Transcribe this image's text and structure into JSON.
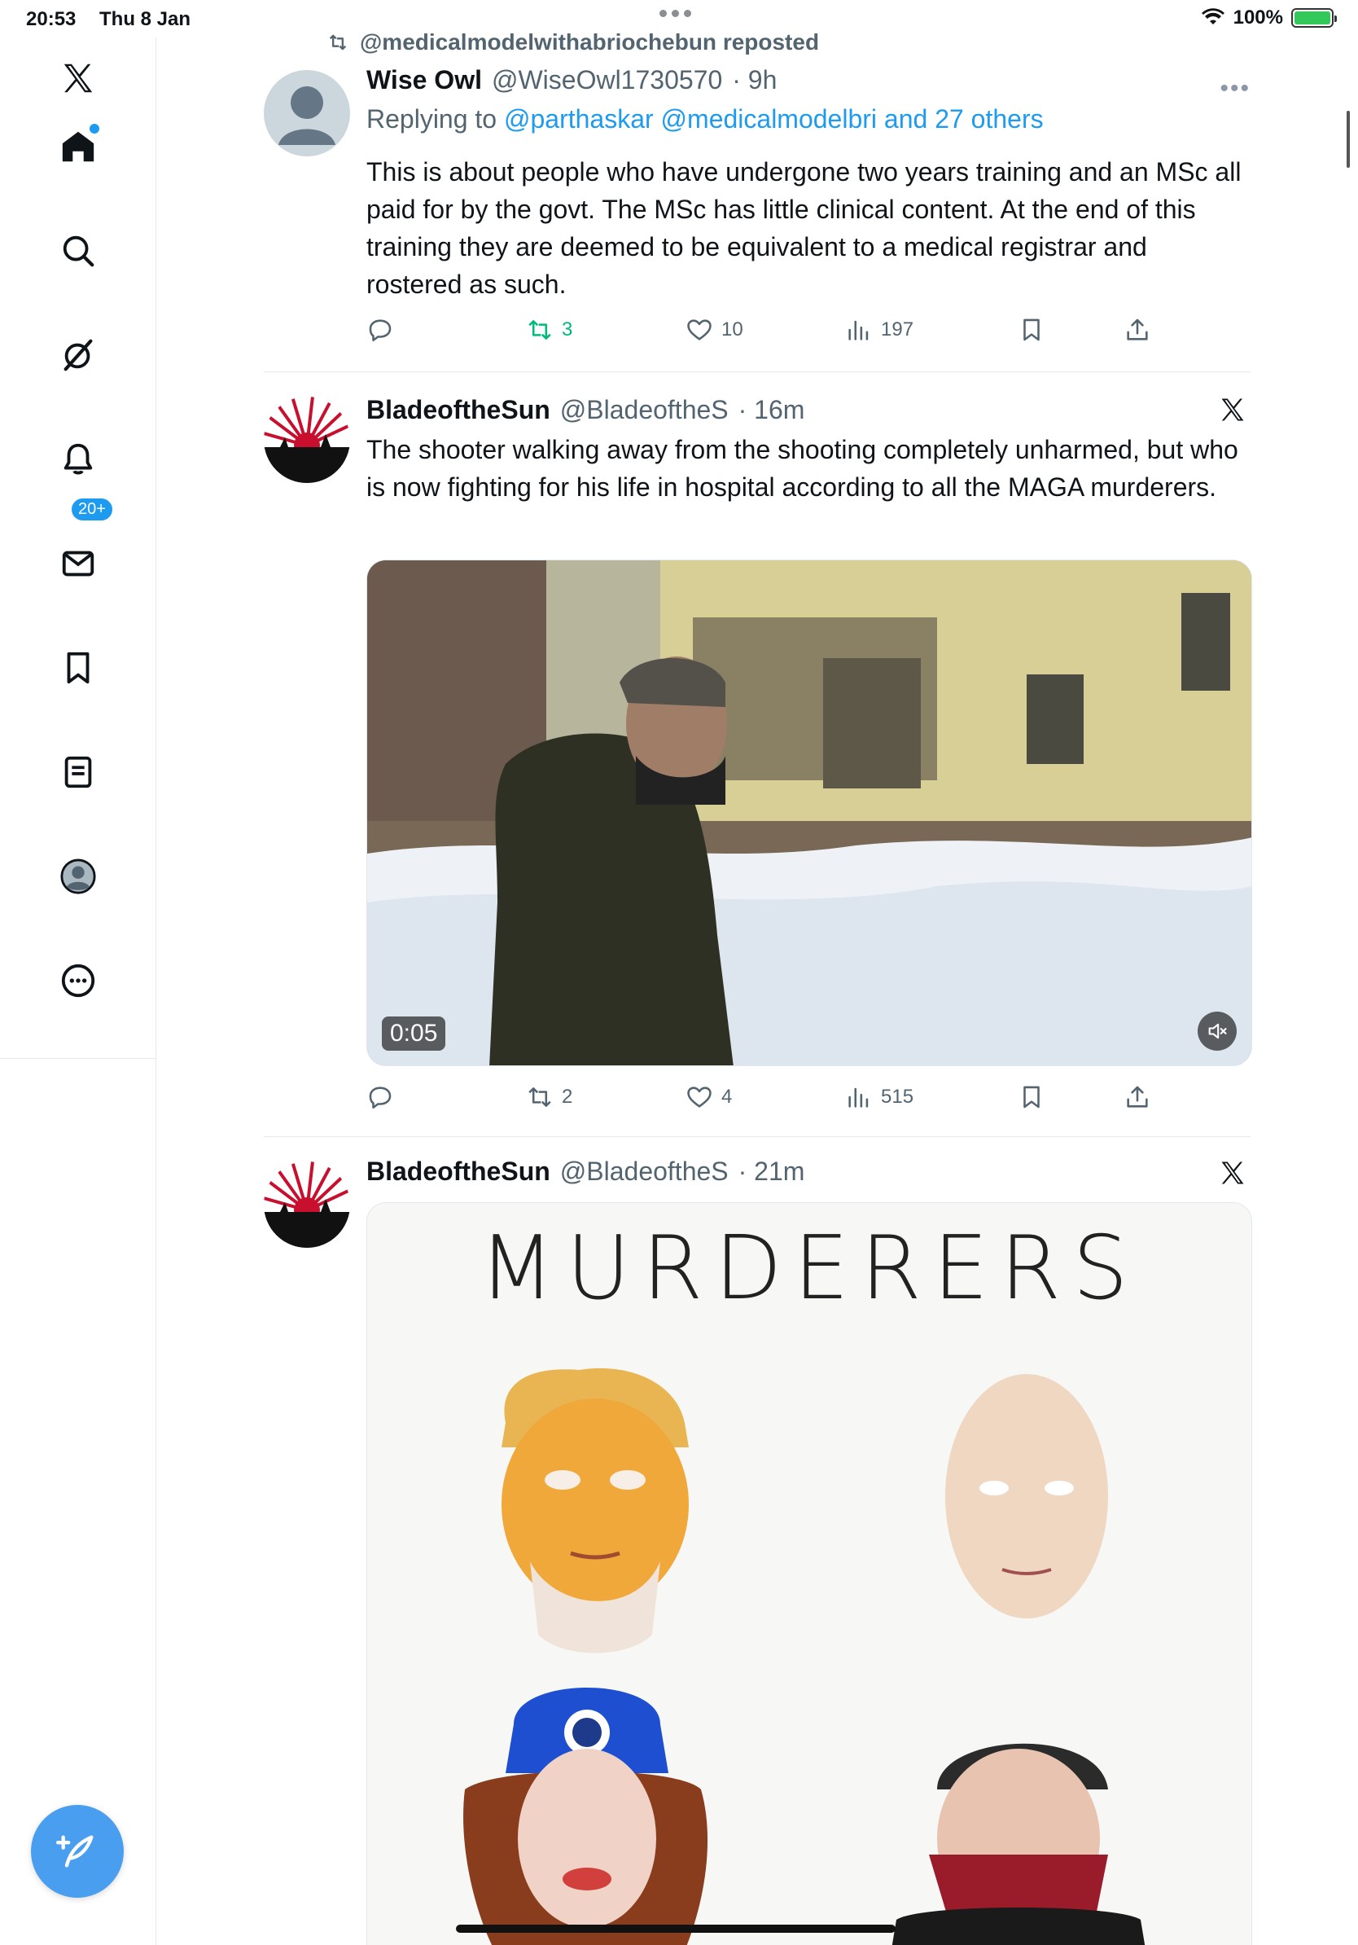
{
  "status_bar": {
    "time": "20:53",
    "date": "Thu 8 Jan",
    "battery": "100%"
  },
  "sidebar": {
    "items": [
      {
        "icon": "x-logo-icon"
      },
      {
        "icon": "home-icon"
      },
      {
        "icon": "search-icon"
      },
      {
        "icon": "grok-icon"
      },
      {
        "icon": "notifications-icon",
        "badge": "20+"
      },
      {
        "icon": "messages-icon"
      },
      {
        "icon": "bookmarks-icon"
      },
      {
        "icon": "lists-icon"
      },
      {
        "icon": "profile-icon"
      },
      {
        "icon": "more-icon"
      }
    ],
    "compose_icon": "compose-icon"
  },
  "feed": {
    "tweet1": {
      "repost_label": "@medicalmodelwithabriochebun reposted",
      "name": "Wise Owl",
      "handle": "@WiseOwl1730570",
      "time": "· 9h",
      "replying_prefix": "Replying to",
      "replying_links": "@parthaskar @medicalmodelbri and 27 others",
      "text": "This is about people who have undergone two years training and an MSc all paid for by the govt. The MSc has little clinical content. At the end of this training they are deemed to be equivalent to a medical registrar and rostered as such.",
      "retweets": "3",
      "likes": "10",
      "views": "197"
    },
    "tweet2": {
      "name": "BladeoftheSun",
      "handle": "@BladeoftheS",
      "time": "· 16m",
      "text": "The shooter walking away from the shooting completely unharmed, but who is now fighting for his life in hospital according to all the MAGA murderers.",
      "video_time": "0:05",
      "retweets": "2",
      "likes": "4",
      "views": "515"
    },
    "tweet3": {
      "name": "BladeoftheSun",
      "handle": "@BladeoftheS",
      "time": "· 21m",
      "image_title": "MURDERERS"
    }
  },
  "colors": {
    "accent": "#1d9bf0",
    "retweet_active": "#00ba7c",
    "secondary_text": "#536471"
  }
}
